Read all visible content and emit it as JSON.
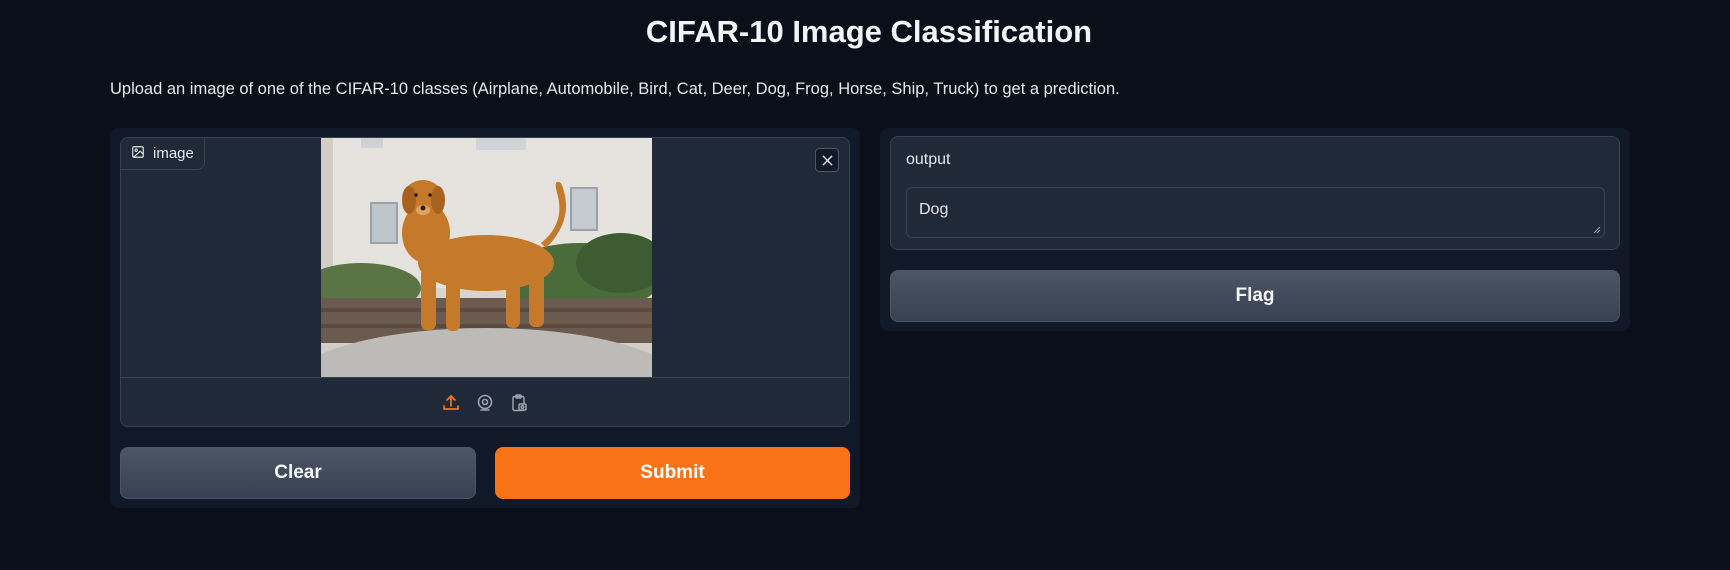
{
  "header": {
    "title": "CIFAR-10 Image Classification",
    "description": "Upload an image of one of the CIFAR-10 classes (Airplane, Automobile, Bird, Cat, Deer, Dog, Frog, Horse, Ship, Truck) to get a prediction."
  },
  "input": {
    "label": "image",
    "label_icon": "image-icon",
    "clear_icon": "close-icon",
    "sources": [
      "upload-icon",
      "webcam-icon",
      "clipboard-icon"
    ]
  },
  "buttons": {
    "clear_label": "Clear",
    "submit_label": "Submit",
    "flag_label": "Flag"
  },
  "output": {
    "label": "output",
    "value": "Dog"
  },
  "colors": {
    "background": "#0b0f19",
    "panel": "#111827",
    "block": "#1f2937",
    "accent": "#f97316",
    "border": "#374151"
  }
}
